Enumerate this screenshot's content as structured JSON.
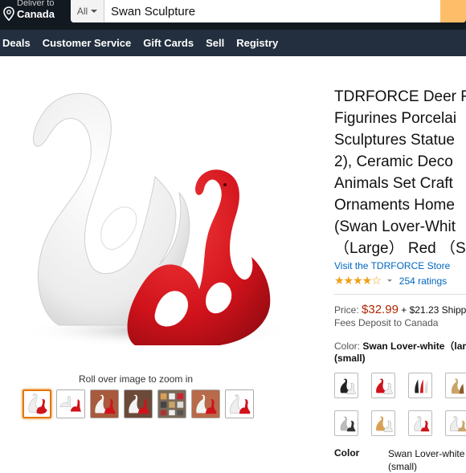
{
  "header": {
    "deliver_line1": "Deliver to",
    "deliver_line2": "Canada",
    "search_scope": "All",
    "search_value": "Swan Sculpture"
  },
  "nav": {
    "items": [
      "Deals",
      "Customer Service",
      "Gift Cards",
      "Sell",
      "Registry"
    ]
  },
  "gallery": {
    "zoom_hint": "Roll over image to zoom in",
    "thumb_count": 7,
    "selected_thumb": 0
  },
  "product": {
    "title_lines": [
      "TDRFORCE Deer F",
      "Figurines Porcelai",
      "Sculptures Statue",
      "2),  Ceramic Deco",
      "Animals Set Craft",
      "Ornaments Home",
      "(Swan Lover-Whit",
      " （Large） Red （S"
    ],
    "store_link": "Visit the TDRFORCE Store",
    "stars": "★★★★☆",
    "rating_value": 4.5,
    "rating_count": "254 ratings",
    "price_label": "Price:",
    "price": "$32.99",
    "shipping": "+ $21.23 Shipp",
    "fees": "Fees Deposit to Canada",
    "color_label": "Color:",
    "color_value": "Swan Lover-white（lar",
    "color_value2": "(small)",
    "spec_key": "Color",
    "spec_val1": "Swan Lover-white",
    "spec_val2": "(small)"
  },
  "colors": {
    "topbar": "#131921",
    "navbar": "#232f3e",
    "price": "#b12704",
    "link": "#0066c0",
    "star": "#f0a017",
    "search_button": "#febd69",
    "selected_thumb_border": "#e77600"
  }
}
